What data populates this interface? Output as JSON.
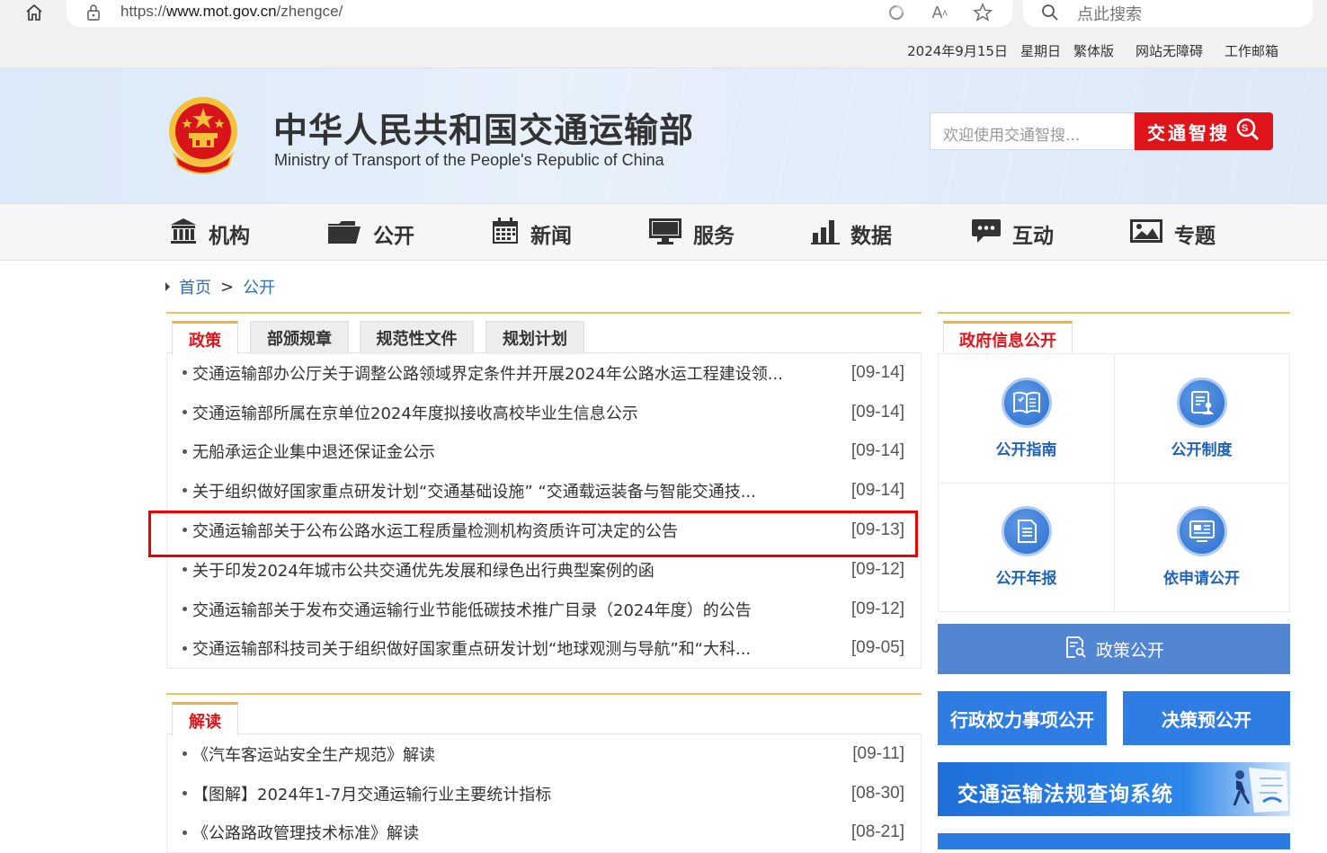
{
  "browser": {
    "url_prefix": "https://",
    "url_domain": "www.mot.gov.cn",
    "url_path": "/zhengce/",
    "search_placeholder": "点此搜索"
  },
  "topbar": {
    "date": "2024年9月15日",
    "weekday": "星期日",
    "traditional": "繁体版",
    "accessibility": "网站无障碍",
    "mail": "工作邮箱"
  },
  "header": {
    "title": "中华人民共和国交通运输部",
    "subtitle": "Ministry of Transport of the People's Republic of China",
    "search_placeholder": "欢迎使用交通智搜...",
    "search_button": "交通智搜"
  },
  "nav": [
    {
      "label": "机构",
      "icon": "building-icon"
    },
    {
      "label": "公开",
      "icon": "folder-icon"
    },
    {
      "label": "新闻",
      "icon": "calendar-icon"
    },
    {
      "label": "服务",
      "icon": "monitor-icon"
    },
    {
      "label": "数据",
      "icon": "bar-chart-icon"
    },
    {
      "label": "互动",
      "icon": "chat-icon"
    },
    {
      "label": "专题",
      "icon": "image-icon"
    }
  ],
  "breadcrumb": {
    "home": "首页",
    "separator": ">",
    "current": "公开"
  },
  "policy": {
    "tabs": [
      "政策",
      "部颁规章",
      "规范性文件",
      "规划计划"
    ],
    "items": [
      {
        "title": "交通运输部办公厅关于调整公路领域界定条件并开展2024年公路水运工程建设领...",
        "date": "[09-14]"
      },
      {
        "title": "交通运输部所属在京单位2024年度拟接收高校毕业生信息公示",
        "date": "[09-14]"
      },
      {
        "title": "无船承运企业集中退还保证金公示",
        "date": "[09-14]"
      },
      {
        "title": "关于组织做好国家重点研发计划“交通基础设施” “交通载运装备与智能交通技...",
        "date": "[09-14]"
      },
      {
        "title": "交通运输部关于公布公路水运工程质量检测机构资质许可决定的公告",
        "date": "[09-13]"
      },
      {
        "title": "关于印发2024年城市公共交通优先发展和绿色出行典型案例的函",
        "date": "[09-12]"
      },
      {
        "title": "交通运输部关于发布交通运输行业节能低碳技术推广目录（2024年度）的公告",
        "date": "[09-12]"
      },
      {
        "title": "交通运输部科技司关于组织做好国家重点研发计划“地球观测与导航”和“大科...",
        "date": "[09-05]"
      }
    ]
  },
  "interpretation": {
    "tab": "解读",
    "items": [
      {
        "title": "《汽车客运站安全生产规范》解读",
        "date": "[09-11]"
      },
      {
        "title": "【图解】2024年1-7月交通运输行业主要统计指标",
        "date": "[08-30]"
      },
      {
        "title": "《公路路政管理技术标准》解读",
        "date": "[08-21]"
      }
    ]
  },
  "gov_info": {
    "tab": "政府信息公开",
    "cells": [
      {
        "label": "公开指南",
        "icon": "book-icon"
      },
      {
        "label": "公开制度",
        "icon": "document-user-icon"
      },
      {
        "label": "公开年报",
        "icon": "report-icon"
      },
      {
        "label": "依申请公开",
        "icon": "apply-icon"
      }
    ],
    "policy_open": "政策公开",
    "admin_power": "行政权力事项公开",
    "decision_preview": "决策预公开",
    "law_search": "交通运输法规查询系统"
  },
  "colors": {
    "accent_red": "#e0141b",
    "link_blue": "#2f6fb6",
    "button_blue": "#2f7de2",
    "tab_gold": "#f2b13a"
  }
}
